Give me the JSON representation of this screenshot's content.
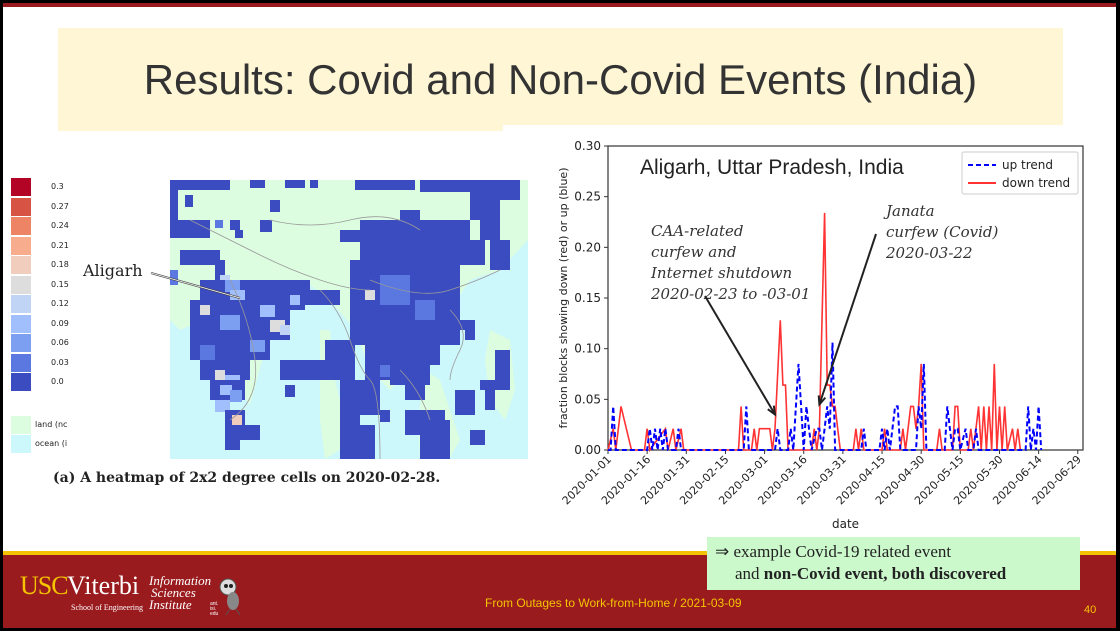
{
  "slide": {
    "title": "Results: Covid and Non-Covid Events (India)",
    "footer_text": "From Outages to Work-from-Home / 2021-03-09",
    "page_number": "40",
    "logo": {
      "usc": "USC",
      "viterbi": "Viterbi",
      "school": "School of Engineering",
      "isi_line1": "Information",
      "isi_line2": "Sciences",
      "isi_line3": "Institute",
      "ant_text": "ant.\nisi.\nedu"
    },
    "note": {
      "arrow": "⇒",
      "line1": "example Covid-19 related event",
      "line2_plain": "and ",
      "line2_bold": "non-Covid event, both discovered"
    },
    "colors": {
      "brand_red": "#991b1e",
      "brand_gold": "#f5c400",
      "title_bg": "#fef6d4",
      "note_bg": "#ccf9cc",
      "up_trend": "#0000ff",
      "down_trend": "#ff3333"
    }
  },
  "heatmap": {
    "label_city": "Aligarh",
    "caption": "(a) A heatmap of 2x2 degree cells on 2020-02-28.",
    "colorbar": [
      {
        "value": "0.3",
        "color": "#b40426"
      },
      {
        "value": "0.27",
        "color": "#d75445"
      },
      {
        "value": "0.24",
        "color": "#ee8466"
      },
      {
        "value": "0.21",
        "color": "#f7ac8e"
      },
      {
        "value": "0.18",
        "color": "#f1cdbd"
      },
      {
        "value": "0.15",
        "color": "#dddddd"
      },
      {
        "value": "0.12",
        "color": "#c0d4f5"
      },
      {
        "value": "0.09",
        "color": "#a0bffc"
      },
      {
        "value": "0.06",
        "color": "#7d9ff1"
      },
      {
        "value": "0.03",
        "color": "#5a78e0"
      },
      {
        "value": "0.0",
        "color": "#3b4cc0"
      }
    ],
    "extra_legend": [
      {
        "label": "land (nc",
        "color": "#ddfde1"
      },
      {
        "label": "ocean (i",
        "color": "#ccf7fb"
      }
    ],
    "land_color": "#ddfde1",
    "ocean_color": "#ccf7fb"
  },
  "chart_data": {
    "type": "line",
    "title": "Aligarh, Uttar Pradesh, India",
    "xlabel": "date",
    "ylabel": "fraction blocks showing down (red) or up (blue)",
    "ylim": [
      0,
      0.3
    ],
    "yticks": [
      "0.00",
      "0.05",
      "0.10",
      "0.15",
      "0.20",
      "0.25",
      "0.30"
    ],
    "xticks": [
      "2020-01-01",
      "2020-01-16",
      "2020-01-31",
      "2020-02-15",
      "2020-03-01",
      "2020-03-16",
      "2020-03-31",
      "2020-04-15",
      "2020-04-30",
      "2020-05-15",
      "2020-05-30",
      "2020-06-14",
      "2020-06-29"
    ],
    "x_range_days": [
      0,
      182
    ],
    "legend": {
      "position": "top-right",
      "entries": [
        {
          "name": "up trend",
          "style": "dashed",
          "color": "#0000ff"
        },
        {
          "name": "down trend",
          "style": "solid",
          "color": "#ff3333"
        }
      ]
    },
    "series": [
      {
        "name": "down trend",
        "color": "#ff3333",
        "points": [
          [
            0,
            0
          ],
          [
            2,
            0.021
          ],
          [
            3,
            0
          ],
          [
            5,
            0.043
          ],
          [
            9,
            0
          ],
          [
            14,
            0
          ],
          [
            15,
            0.021
          ],
          [
            16,
            0
          ],
          [
            22,
            0.021
          ],
          [
            23,
            0
          ],
          [
            25,
            0.021
          ],
          [
            26,
            0
          ],
          [
            28,
            0.021
          ],
          [
            29,
            0
          ],
          [
            32,
            0
          ],
          [
            50,
            0
          ],
          [
            51,
            0.043
          ],
          [
            52,
            0
          ],
          [
            55,
            0
          ],
          [
            56,
            0.021
          ],
          [
            57,
            0
          ],
          [
            58,
            0.021
          ],
          [
            62,
            0.021
          ],
          [
            63,
            0
          ],
          [
            64,
            0.021
          ],
          [
            66,
            0.128
          ],
          [
            67,
            0.064
          ],
          [
            68,
            0.064
          ],
          [
            69,
            0
          ],
          [
            78,
            0
          ],
          [
            79,
            0.021
          ],
          [
            80,
            0
          ],
          [
            81,
            0.021
          ],
          [
            83,
            0.234
          ],
          [
            84,
            0.064
          ],
          [
            85,
            0.064
          ],
          [
            86,
            0.043
          ],
          [
            87,
            0.043
          ],
          [
            88,
            0.021
          ],
          [
            89,
            0
          ],
          [
            94,
            0
          ],
          [
            95,
            0.021
          ],
          [
            96,
            0
          ],
          [
            97,
            0.021
          ],
          [
            98,
            0
          ],
          [
            105,
            0
          ],
          [
            106,
            0.021
          ],
          [
            107,
            0
          ],
          [
            112,
            0
          ],
          [
            113,
            0.021
          ],
          [
            114,
            0
          ],
          [
            116,
            0.043
          ],
          [
            117,
            0.043
          ],
          [
            118,
            0.021
          ],
          [
            119,
            0.043
          ],
          [
            120,
            0.085
          ],
          [
            121,
            0
          ],
          [
            126,
            0
          ],
          [
            127,
            0.021
          ],
          [
            128,
            0
          ],
          [
            132,
            0
          ],
          [
            133,
            0.043
          ],
          [
            134,
            0.043
          ],
          [
            135,
            0
          ],
          [
            138,
            0
          ],
          [
            139,
            0.021
          ],
          [
            140,
            0
          ],
          [
            142,
            0.043
          ],
          [
            143,
            0
          ],
          [
            144,
            0.043
          ],
          [
            145,
            0
          ],
          [
            146,
            0.043
          ],
          [
            147,
            0
          ],
          [
            148,
            0.085
          ],
          [
            149,
            0
          ],
          [
            150,
            0.043
          ],
          [
            151,
            0
          ],
          [
            152,
            0.043
          ],
          [
            153,
            0
          ],
          [
            155,
            0.021
          ],
          [
            156,
            0
          ],
          [
            157,
            0.021
          ],
          [
            158,
            0
          ]
        ]
      },
      {
        "name": "up trend",
        "color": "#0000ff",
        "points": [
          [
            0,
            0
          ],
          [
            1,
            0
          ],
          [
            2,
            0.043
          ],
          [
            3,
            0
          ],
          [
            15,
            0
          ],
          [
            16,
            0.021
          ],
          [
            17,
            0
          ],
          [
            18,
            0.021
          ],
          [
            19,
            0
          ],
          [
            20,
            0.021
          ],
          [
            21,
            0
          ],
          [
            22,
            0.021
          ],
          [
            23,
            0
          ],
          [
            26,
            0
          ],
          [
            27,
            0.021
          ],
          [
            28,
            0
          ],
          [
            52,
            0
          ],
          [
            53,
            0.043
          ],
          [
            54,
            0
          ],
          [
            64,
            0
          ],
          [
            65,
            0.021
          ],
          [
            66,
            0
          ],
          [
            69,
            0
          ],
          [
            70,
            0.021
          ],
          [
            71,
            0
          ],
          [
            72,
            0.043
          ],
          [
            73,
            0.085
          ],
          [
            74,
            0.043
          ],
          [
            75,
            0
          ],
          [
            76,
            0.043
          ],
          [
            77,
            0.021
          ],
          [
            78,
            0
          ],
          [
            80,
            0.021
          ],
          [
            81,
            0.021
          ],
          [
            82,
            0
          ],
          [
            83,
            0.021
          ],
          [
            84,
            0.043
          ],
          [
            85,
            0.021
          ],
          [
            86,
            0.106
          ],
          [
            87,
            0
          ],
          [
            97,
            0
          ],
          [
            98,
            0.021
          ],
          [
            99,
            0
          ],
          [
            104,
            0
          ],
          [
            105,
            0.021
          ],
          [
            106,
            0
          ],
          [
            107,
            0.021
          ],
          [
            108,
            0
          ],
          [
            110,
            0.043
          ],
          [
            111,
            0.043
          ],
          [
            112,
            0
          ],
          [
            118,
            0
          ],
          [
            119,
            0.043
          ],
          [
            120,
            0.021
          ],
          [
            121,
            0.085
          ],
          [
            122,
            0
          ],
          [
            129,
            0
          ],
          [
            130,
            0.043
          ],
          [
            131,
            0.021
          ],
          [
            132,
            0
          ],
          [
            133,
            0.021
          ],
          [
            134,
            0.021
          ],
          [
            135,
            0
          ],
          [
            137,
            0.021
          ],
          [
            138,
            0
          ],
          [
            140,
            0
          ],
          [
            141,
            0.021
          ],
          [
            142,
            0
          ],
          [
            160,
            0
          ],
          [
            161,
            0.043
          ],
          [
            162,
            0
          ],
          [
            163,
            0.021
          ],
          [
            164,
            0
          ],
          [
            165,
            0.043
          ],
          [
            166,
            0
          ]
        ]
      }
    ],
    "annotations": [
      {
        "text": "CAA-related\ncurfew and\nInternet shutdown\n2020-02-23 to -03-01",
        "points_to_day": 64,
        "points_to_value": 0.035
      },
      {
        "text": "Janata\ncurfew (Covid)\n2020-03-22",
        "points_to_day": 81,
        "points_to_value": 0.045
      }
    ]
  }
}
